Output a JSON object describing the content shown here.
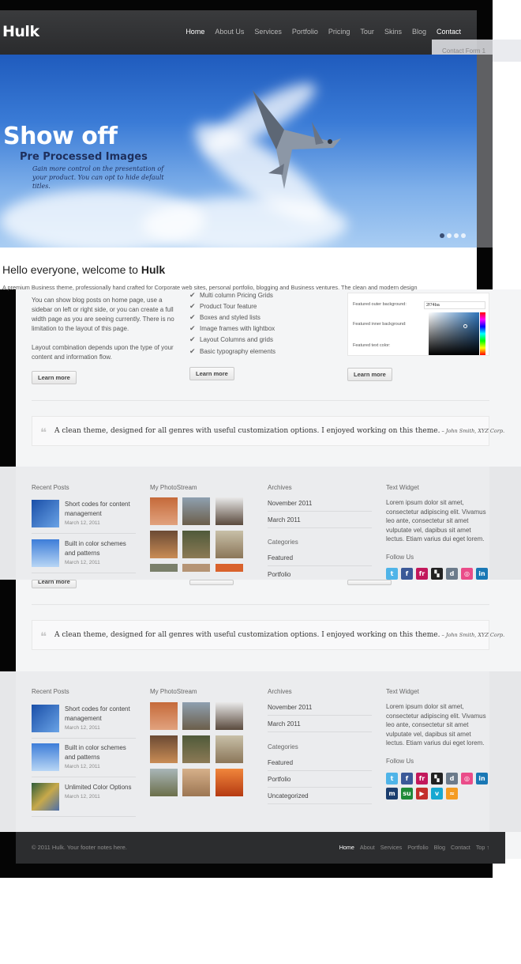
{
  "header": {
    "logo": "Hulk",
    "nav": [
      "Home",
      "About Us",
      "Services",
      "Portfolio",
      "Pricing",
      "Tour",
      "Skins",
      "Blog",
      "Contact"
    ],
    "active_nav": "Home",
    "submenu_item": "Contact Form 1"
  },
  "hero": {
    "title": "Show off",
    "subtitle": "Pre Processed Images",
    "text": "Gain more control on the presentation of your product. You can opt to hide default titles.",
    "slides": 4,
    "active_slide": 1
  },
  "intro": {
    "heading_prefix": "Hello everyone, welcome to ",
    "heading_brand": "Hulk",
    "text": "A premium Business theme, professionally hand crafted for Corporate web sites, personal portfolio, blogging and Business ventures. The clean and modern design"
  },
  "features": {
    "col1_p1": "You can show blog posts on home page, use a sidebar on left or right side, or you can create a full width page as you are seeing currently. There is no limitation to the layout of this page.",
    "col1_p2": "Layout combination depends upon the type of your content and information flow.",
    "list": [
      "Multi column Pricing Grids",
      "Product Tour feature",
      "Boxes and styled lists",
      "Image frames with lightbox",
      "Layout Columns and grids",
      "Basic typography elements"
    ],
    "settings": {
      "outer_label": "Featured outer background:",
      "outer_value": "2f74ba",
      "inner_label": "Featured inner background:",
      "text_label": "Featured text color:"
    },
    "learn_more": "Learn more"
  },
  "quote": {
    "text": "A clean theme, designed for all genres with useful customization options. I enjoyed working on this theme.",
    "author": " – John Smith, XYZ Corp."
  },
  "widgets": {
    "recent_posts_title": "Recent Posts",
    "posts": [
      {
        "title": "Short codes for content management",
        "date": "March 12, 2011"
      },
      {
        "title": "Built in color schemes and patterns",
        "date": "March 12, 2011"
      },
      {
        "title": "Unlimited Color Options",
        "date": "March 12, 2011"
      }
    ],
    "photostream_title": "My PhotoStream",
    "archives_title": "Archives",
    "archives": [
      "November 2011",
      "March 2011"
    ],
    "categories_title": "Categories",
    "categories": [
      "Featured",
      "Portfolio",
      "Uncategorized"
    ],
    "text_widget_title": "Text Widget",
    "text_widget": "Lorem ipsum dolor sit amet, consectetur adipiscing elit. Vivamus leo ante, consectetur sit amet vulputate vel, dapibus sit amet lectus. Etiam varius dui eget lorem.",
    "follow_title": "Follow Us",
    "social_row1": [
      {
        "name": "twitter",
        "glyph": "t",
        "color": "#4fb4e8"
      },
      {
        "name": "facebook",
        "glyph": "f",
        "color": "#3b5998"
      },
      {
        "name": "friendfeed",
        "glyph": "fr",
        "color": "#c2185b"
      },
      {
        "name": "delicious",
        "glyph": "▚",
        "color": "#222222"
      },
      {
        "name": "digg",
        "glyph": "d",
        "color": "#6c7b8b"
      },
      {
        "name": "dribbble",
        "glyph": "◎",
        "color": "#ea4c89"
      },
      {
        "name": "linkedin",
        "glyph": "in",
        "color": "#1a78b5"
      }
    ],
    "social_row2": [
      {
        "name": "myspace",
        "glyph": "m",
        "color": "#1b3d6e"
      },
      {
        "name": "stumbleupon",
        "glyph": "su",
        "color": "#1f8a38"
      },
      {
        "name": "youtube",
        "glyph": "▶",
        "color": "#c4302b"
      },
      {
        "name": "vimeo",
        "glyph": "v",
        "color": "#17a8d1"
      },
      {
        "name": "rss",
        "glyph": "≈",
        "color": "#f49b22"
      }
    ]
  },
  "footer": {
    "copyright": "© 2011 Hulk. Your footer notes here.",
    "nav": [
      "Home",
      "About",
      "Services",
      "Portfolio",
      "Blog",
      "Contact",
      "Top ↑"
    ]
  }
}
